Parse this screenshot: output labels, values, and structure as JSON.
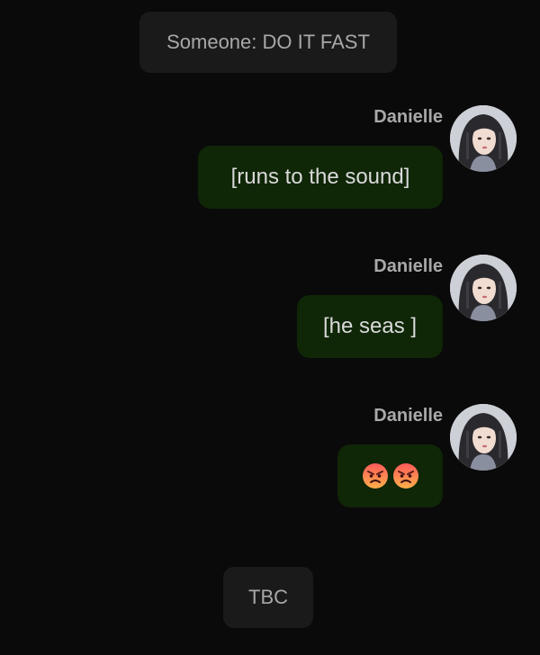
{
  "messages": [
    {
      "type": "system",
      "text": "Someone: DO IT FAST"
    },
    {
      "type": "outgoing",
      "sender": "Danielle",
      "text": "[runs to the sound]"
    },
    {
      "type": "outgoing",
      "sender": "Danielle",
      "text": "[he seas ]"
    },
    {
      "type": "outgoing",
      "sender": "Danielle",
      "text": "😡😡",
      "emoji": "angry-face-icon",
      "emoji_count": 2
    },
    {
      "type": "system",
      "text": "TBC"
    }
  ],
  "colors": {
    "background": "#0a0a0a",
    "system_bubble": "#1a1a1a",
    "outgoing_bubble": "#0f2607",
    "sender_name": "#a9a9a9",
    "bubble_text": "#d9d9d9"
  }
}
